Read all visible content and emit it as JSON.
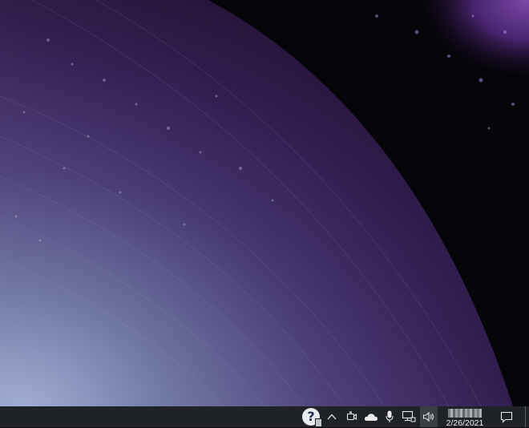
{
  "wallpaper": {
    "description_colors": {
      "dark": "#050408",
      "purple": "#4a2a6e",
      "steel": "#6f7c9a"
    }
  },
  "taskbar": {
    "background": "#1f2327",
    "tray": {
      "help_icon_glyph": "?",
      "items": [
        {
          "icon": "help-app-icon"
        },
        {
          "icon": "chevron-up-icon"
        },
        {
          "icon": "camera-icon"
        },
        {
          "icon": "onedrive-cloud-icon"
        },
        {
          "icon": "microphone-icon"
        },
        {
          "icon": "network-icon"
        },
        {
          "icon": "speaker-volume-icon"
        }
      ]
    },
    "clock": {
      "date": "2/26/2021"
    },
    "notifications_icon": "action-center-icon"
  }
}
